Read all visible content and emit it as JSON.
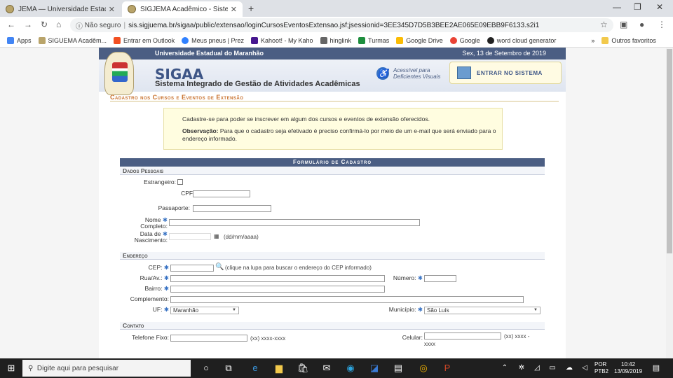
{
  "browser": {
    "tabs": [
      {
        "title": "JEMA — Universidade Estadual d",
        "active": false
      },
      {
        "title": "SIGJEMA Acadêmico - Sistema Ir",
        "active": true
      }
    ],
    "address": {
      "security": "Não seguro",
      "url": "sis.sigjuema.br/sigaa/public/extensao/loginCursosEventosExtensao.jsf;jsessionid=3EE345D7D5B3BEE2AE065E09EBB9F6133.s2i1"
    },
    "bookmarks": [
      "Apps",
      "SIGUEMA Acadêm...",
      "Entrar em Outlook",
      "Meus pneus | Prez",
      "Kahoot! - My Kaho",
      "hinglink",
      "Turmas",
      "Google Drive",
      "Google",
      "word cloud generator",
      "Outros favoritos"
    ]
  },
  "header": {
    "university": "Universidade Estadual do Maranhão",
    "date": "Sex, 13 de Setembro de 2019",
    "brand": "SIGAA",
    "subtitle": "Sistema Integrado de Gestão de Atividades Acadêmicas",
    "access_text_1": "Acessível para",
    "access_text_2": "Deficientes Visuais",
    "login_label": "ENTRAR NO SISTEMA"
  },
  "section_title": "Cadastro nos Cursos e Eventos de Extensão",
  "notice": {
    "line1": "Cadastre-se para poder se inscrever em algum dos cursos e eventos de extensão oferecidos.",
    "obs_label": "Observação:",
    "obs_text": "Para que o cadastro seja efetivado é preciso confirmá-lo por meio de um e-mail que será enviado para o endereço informado."
  },
  "form": {
    "title": "Formulário de Cadastro",
    "groups": {
      "personal": "Dados Pessoais",
      "address": "Endereço",
      "contact": "Contato"
    },
    "labels": {
      "foreign": "Estrangeiro:",
      "cpf": "CPF:",
      "passport": "Passaporte:",
      "name_1": "Nome",
      "name_2": "Completo:",
      "birth_1": "Data de",
      "birth_2": "Nascimento:",
      "cep": "CEP:",
      "street": "Rua/Av.:",
      "number": "Número:",
      "district": "Bairro:",
      "complement": "Complemento:",
      "uf": "UF:",
      "city": "Município:",
      "phone": "Telefone Fixo:",
      "cell": "Celular:"
    },
    "hints": {
      "date": "(dd/mm/aaaa)",
      "cep": "(clique na lupa para buscar o endereço do CEP informado)",
      "phone": "(xx) xxxx-xxxx",
      "cell_1": "(xx) xxxx -",
      "cell_2": "xxxx"
    },
    "values": {
      "uf": "Maranhão",
      "city": "São Luís"
    }
  },
  "taskbar": {
    "search_placeholder": "Digite aqui para pesquisar",
    "lang_1": "POR",
    "lang_2": "PTB2",
    "time": "10:42",
    "date": "13/09/2019"
  }
}
